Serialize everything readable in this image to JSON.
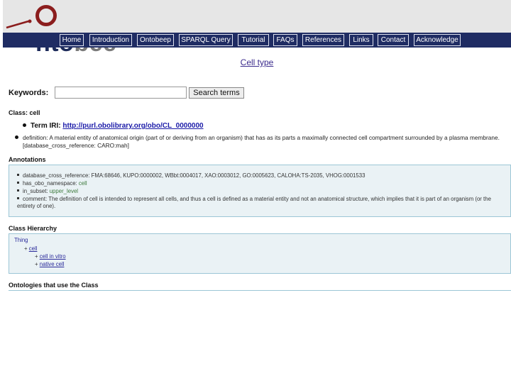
{
  "header": {
    "logo_text": "Ontobee"
  },
  "nav": {
    "items": [
      "Home",
      "Introduction",
      "Ontobeep",
      "SPARQL Query",
      "Tutorial",
      "FAQs",
      "References",
      "Links",
      "Contact",
      "Acknowledge"
    ]
  },
  "page": {
    "title": "Cell type"
  },
  "search": {
    "label": "Keywords:",
    "value": "",
    "button": "Search terms"
  },
  "class": {
    "heading": "Class: cell",
    "iri_label": "Term IRI:",
    "iri": "http://purl.obolibrary.org/obo/CL_0000000",
    "definition": "definition: A material entity of anatomical origin (part of or deriving from an organism) that has as its parts a maximally connected cell compartment surrounded by a plasma membrane. [database_cross_reference: CARO:mah]"
  },
  "annotations": {
    "heading": "Annotations",
    "items": [
      {
        "text": "database_cross_reference: FMA:68646, KUPO:0000002, WBbt:0004017, XAO:0003012, GO:0005623, CALOHA:TS-2035, VHOG:0001533"
      },
      {
        "label": "has_obo_namespace:",
        "link": "cell"
      },
      {
        "label": "in_subset:",
        "link": "upper_level"
      },
      {
        "text": "comment: The definition of cell is intended to represent all cells, and thus a cell is defined as a material entity and not an anatomical structure, which implies that it is part of an organism (or the entirety of one)."
      }
    ]
  },
  "hierarchy": {
    "heading": "Class Hierarchy",
    "root": "Thing",
    "level1": "cell",
    "children": [
      "cell in vitro",
      "native cell"
    ]
  },
  "ontologies": {
    "heading": "Ontologies that use the Class"
  }
}
